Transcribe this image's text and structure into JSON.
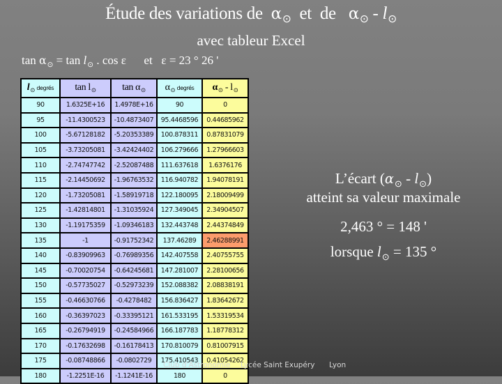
{
  "title": {
    "prefix": "Étude des variations de  ",
    "alpha": "α",
    "sun": "⊙",
    "middle": "  et  de   ",
    "dash": " - ",
    "l": "l"
  },
  "subtitle": "avec tableur Excel",
  "formula": {
    "tan": "tan ",
    "alpha": "α",
    "sun": "⊙",
    "eq_tan": " = tan ",
    "l": "l",
    "cos": " . cos ε",
    "and": "      et   ε = 23 ° 26 '"
  },
  "table": {
    "headers": [
      {
        "main": "l",
        "sub": " degrés"
      },
      {
        "main": "tan l",
        "sub": ""
      },
      {
        "main": "tan α",
        "sub": ""
      },
      {
        "main": "α",
        "sub": " degrés"
      },
      {
        "main": "α",
        "sub": " - l"
      }
    ],
    "rows": [
      [
        "90",
        "1.6325E+16",
        "1.4978E+16",
        "90",
        "0"
      ],
      [
        "95",
        "-11.4300523",
        "-10.4873407",
        "95.4468596",
        "0.44685962"
      ],
      [
        "100",
        "-5.67128182",
        "-5.20353389",
        "100.878311",
        "0.87831079"
      ],
      [
        "105",
        "-3.73205081",
        "-3.42424402",
        "106.279666",
        "1.27966603"
      ],
      [
        "110",
        "-2.74747742",
        "-2.52087488",
        "111.637618",
        "1.6376176"
      ],
      [
        "115",
        "-2.14450692",
        "-1.96763532",
        "116.940782",
        "1.94078191"
      ],
      [
        "120",
        "-1.73205081",
        "-1.58919718",
        "122.180095",
        "2.18009499"
      ],
      [
        "125",
        "-1.42814801",
        "-1.31035924",
        "127.349045",
        "2.34904507"
      ],
      [
        "130",
        "-1.19175359",
        "-1.09346183",
        "132.443748",
        "2.44374849"
      ],
      [
        "135",
        "-1",
        "-0.91752342",
        "137.46289",
        "2.46288991"
      ],
      [
        "140",
        "-0.83909963",
        "-0.76989356",
        "142.407558",
        "2.40755755"
      ],
      [
        "145",
        "-0.70020754",
        "-0.64245681",
        "147.281007",
        "2.28100656"
      ],
      [
        "150",
        "-0.57735027",
        "-0.52973239",
        "152.088382",
        "2.08838191"
      ],
      [
        "155",
        "-0.46630766",
        "-0.4278482",
        "156.836427",
        "1.83642672"
      ],
      [
        "160",
        "-0.36397023",
        "-0.33395121",
        "161.533195",
        "1.53319534"
      ],
      [
        "165",
        "-0.26794919",
        "-0.24584966",
        "166.187783",
        "1.18778312"
      ],
      [
        "170",
        "-0.17632698",
        "-0.16178413",
        "170.810079",
        "0.81007915"
      ],
      [
        "175",
        "-0.08748866",
        "-0.0802729",
        "175.410543",
        "0.41054262"
      ],
      [
        "180",
        "-1.2251E-16",
        "-1.1241E-16",
        "180",
        "0"
      ]
    ],
    "highlight_row": 9,
    "colors": {
      "col_l": "#ccfcfc",
      "col_tan": "#ccccfc",
      "col_alpha": "#ccfcfc",
      "col_diff": "#fcfc9c",
      "highlight": "#fc9c6c"
    }
  },
  "conclusion": {
    "line1_prefix": "L’écart  (",
    "alpha": "α",
    "sun": "⊙",
    "dash": " - ",
    "l": "l",
    "line1_suffix": ")",
    "line2": "atteint sa valeur maximale",
    "line3": "2,463 ° = 148 '",
    "line4_prefix": "lorsque ",
    "line4_suffix": " = 135 °"
  },
  "footer": {
    "club": "Club d'Astronomie",
    "school": "Lycée Saint Exupéry",
    "city": "Lyon"
  }
}
